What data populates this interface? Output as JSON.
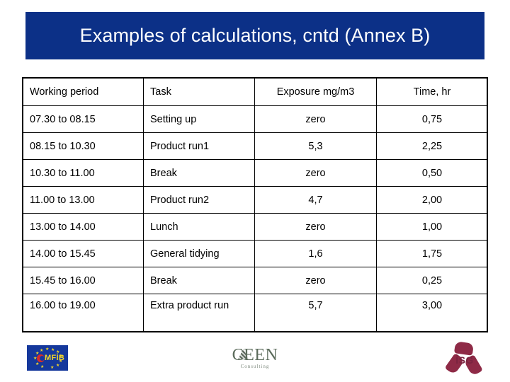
{
  "slide": {
    "title": "Examples of calculations, cntd  (Annex B)",
    "banner_color": "#0c3087",
    "title_color": "#ffffff",
    "background_color": "#ffffff"
  },
  "table": {
    "headers": [
      "Working period",
      "Task",
      "Exposure mg/m3",
      "Time, hr"
    ],
    "rows": [
      {
        "period": "07.30 to 08.15",
        "task": "Setting up",
        "exposure": "zero",
        "time": "0,75"
      },
      {
        "period": "08.15 to 10.30",
        "task": "Product run1",
        "exposure": "5,3",
        "time": "2,25"
      },
      {
        "period": "10.30 to 11.00",
        "task": "Break",
        "exposure": "zero",
        "time": "0,50"
      },
      {
        "period": "11.00 to 13.00",
        "task": "Product run2",
        "exposure": "4,7",
        "time": "2,00"
      },
      {
        "period": "13.00 to 14.00",
        "task": "Lunch",
        "exposure": "zero",
        "time": "1,00"
      },
      {
        "period": "14.00 to 15.45",
        "task": "General tidying",
        "exposure": "1,6",
        "time": "1,75"
      },
      {
        "period": "15.45 to 16.00",
        "task": "Break",
        "exposure": "zero",
        "time": "0,25"
      },
      {
        "period": "16.00 to 19.00",
        "task": "Extra product run",
        "exposure": "5,7",
        "time": "3,00"
      }
    ]
  },
  "footer": {
    "logos": [
      {
        "name": "mfib-logo",
        "text": "MFİB"
      },
      {
        "name": "ceen-logo",
        "text": "CEEN",
        "subtext": "Consulting"
      },
      {
        "name": "isg-logo",
        "text": "İSG"
      }
    ]
  }
}
